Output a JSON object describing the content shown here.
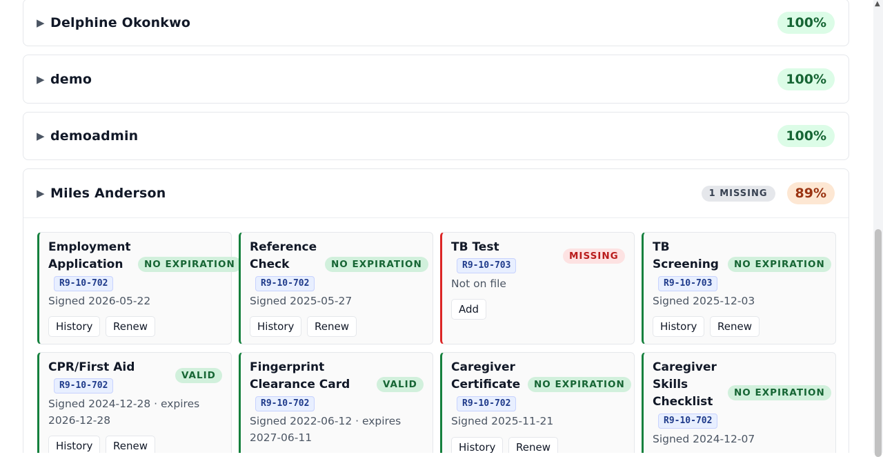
{
  "people": [
    {
      "name": "Delphine Okonkwo",
      "percent": "100%"
    },
    {
      "name": "demo",
      "percent": "100%"
    },
    {
      "name": "demoadmin",
      "percent": "100%"
    },
    {
      "name": "Miles Anderson",
      "percent": "89%",
      "missing_badge": "1 MISSING"
    }
  ],
  "caret_glyph": "▶",
  "cards": [
    {
      "title_line1": "Employment",
      "title_line2": "Application",
      "status": "NO EXPIRATION",
      "code": "R9-10-702",
      "meta": "Signed 2026-05-22",
      "btn1": "History",
      "btn2": "Renew"
    },
    {
      "title_line1": "Reference",
      "title_line2": "Check",
      "status": "NO EXPIRATION",
      "code": "R9-10-702",
      "meta": "Signed 2025-05-27",
      "btn1": "History",
      "btn2": "Renew"
    },
    {
      "title_line1": "TB Test",
      "status": "MISSING",
      "code": "R9-10-703",
      "meta": "Not on file",
      "btn1": "Add"
    },
    {
      "title_line1": "TB",
      "title_line2": "Screening",
      "status": "NO EXPIRATION",
      "code": "R9-10-703",
      "meta": "Signed 2025-12-03",
      "btn1": "History",
      "btn2": "Renew"
    },
    {
      "title_line1": "CPR/First Aid",
      "status": "VALID",
      "code": "R9-10-702",
      "meta_line1": "Signed 2024-12-28 · expires",
      "meta_line2": "2026-12-28",
      "btn1": "History",
      "btn2": "Renew"
    },
    {
      "title_line1": "Fingerprint",
      "title_line2": "Clearance Card",
      "status": "VALID",
      "code": "R9-10-702",
      "meta_line1": "Signed 2022-06-12 · expires",
      "meta_line2": "2027-06-11"
    },
    {
      "title_line1": "Caregiver",
      "title_line2": "Certificate",
      "status": "NO EXPIRATION",
      "code": "R9-10-702",
      "meta": "Signed 2025-11-21",
      "btn1": "History",
      "btn2": "Renew"
    },
    {
      "title_line1": "Caregiver",
      "title_line2": "Skills",
      "title_line3": "Checklist",
      "status": "NO EXPIRATION",
      "code": "R9-10-702",
      "meta": "Signed 2024-12-07"
    }
  ]
}
